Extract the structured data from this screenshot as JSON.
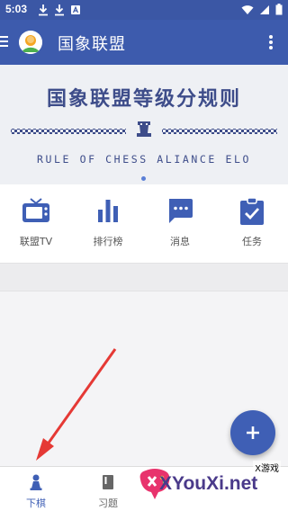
{
  "status_bar": {
    "time": "5:03"
  },
  "app_bar": {
    "title": "国象联盟"
  },
  "banner": {
    "title_cn": "国象联盟等级分规则",
    "title_en": "RULE OF CHESS ALIANCE ELO"
  },
  "quick_nav": [
    {
      "label": "联盟TV",
      "icon": "tv-icon"
    },
    {
      "label": "排行榜",
      "icon": "bar-chart-icon"
    },
    {
      "label": "消息",
      "icon": "message-icon"
    },
    {
      "label": "任务",
      "icon": "task-clipboard-icon"
    }
  ],
  "bottom_nav": [
    {
      "label": "下棋",
      "icon": "pawn-icon",
      "active": true
    },
    {
      "label": "习题",
      "icon": "book-icon",
      "active": false
    }
  ],
  "watermark": {
    "badge": "X游戏",
    "site": "XYouXi.net"
  },
  "colors": {
    "primary": "#3d5bad",
    "icon_blue": "#3f5fb5",
    "banner_text": "#3e4d8a",
    "arrow_red": "#e53935"
  }
}
